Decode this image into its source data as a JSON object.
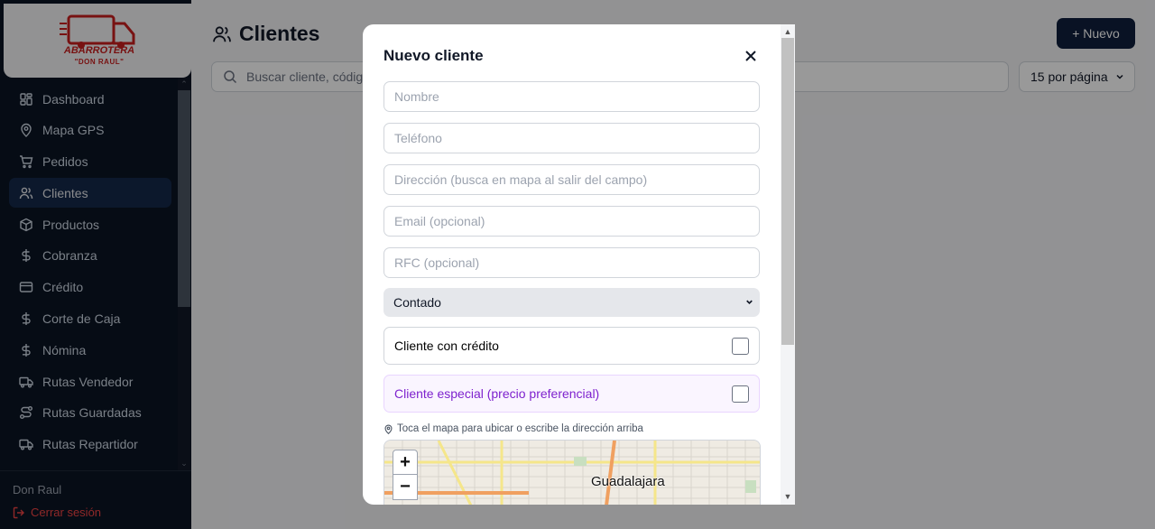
{
  "brand": {
    "name": "ABARROTERA",
    "sub": "\"DON RAUL\"",
    "color": "#c81e1e"
  },
  "sidebar": {
    "items": [
      {
        "label": "Dashboard",
        "icon": "dashboard-icon"
      },
      {
        "label": "Mapa GPS",
        "icon": "map-pin-icon"
      },
      {
        "label": "Pedidos",
        "icon": "cart-icon"
      },
      {
        "label": "Clientes",
        "icon": "users-icon",
        "active": true
      },
      {
        "label": "Productos",
        "icon": "box-icon"
      },
      {
        "label": "Cobranza",
        "icon": "dollar-icon"
      },
      {
        "label": "Crédito",
        "icon": "credit-card-icon"
      },
      {
        "label": "Corte de Caja",
        "icon": "dollar-icon"
      },
      {
        "label": "Nómina",
        "icon": "dollar-icon"
      },
      {
        "label": "Rutas Vendedor",
        "icon": "truck-icon"
      },
      {
        "label": "Rutas Guardadas",
        "icon": "route-icon"
      },
      {
        "label": "Rutas Repartidor",
        "icon": "truck-icon"
      }
    ],
    "user": "Don Raul",
    "logout": "Cerrar sesión"
  },
  "main": {
    "title": "Clientes",
    "new_button": "+ Nuevo",
    "search_placeholder": "Buscar cliente, código",
    "per_page": "15 por página"
  },
  "modal": {
    "title": "Nuevo cliente",
    "fields": {
      "nombre": "Nombre",
      "telefono": "Teléfono",
      "direccion": "Dirección (busca en mapa al salir del campo)",
      "email": "Email (opcional)",
      "rfc": "RFC (opcional)"
    },
    "payment_type": "Contado",
    "credit_label": "Cliente con crédito",
    "credit_checked": false,
    "special_label": "Cliente especial (precio preferencial)",
    "special_checked": false,
    "map_hint": "Toca el mapa para ubicar o escribe la dirección arriba",
    "map_city": "Guadalajara",
    "zoom_in": "+",
    "zoom_out": "−"
  },
  "colors": {
    "sidebar_bg": "#0b1424",
    "active_bg": "#15294a",
    "primary_btn": "#0f1f3d",
    "special_text": "#7e22ce",
    "logout_text": "#ef4444"
  }
}
